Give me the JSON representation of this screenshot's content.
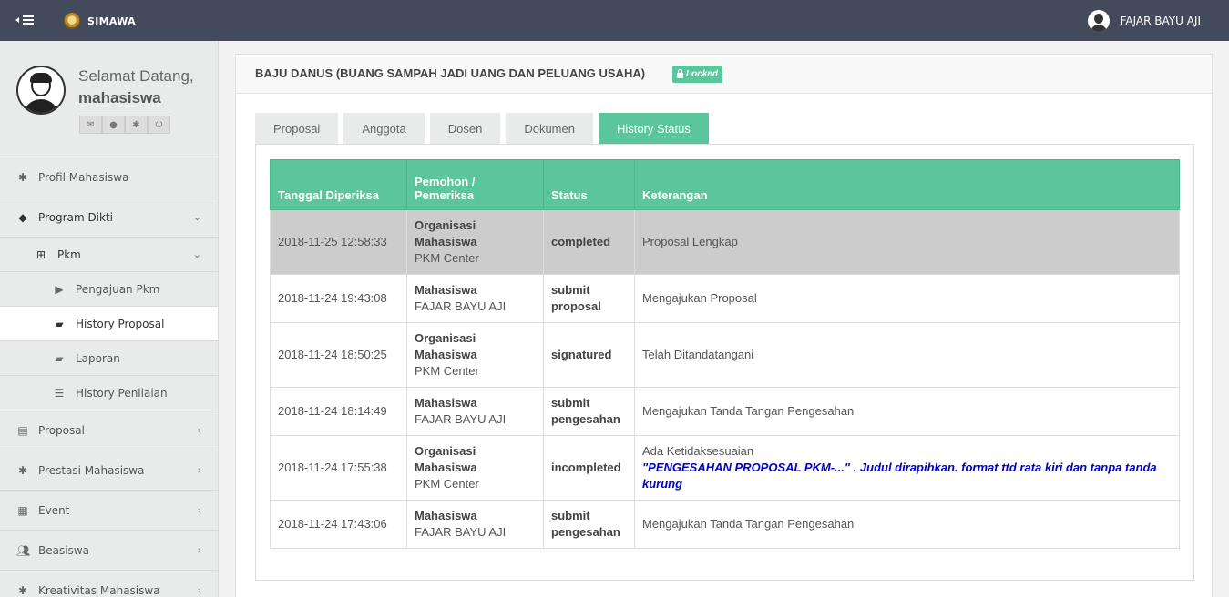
{
  "topbar": {
    "app_name": "SIMAWA",
    "user_name": "FAJAR BAYU AJI"
  },
  "sidebar": {
    "greeting": "Selamat Datang,",
    "role": "mahasiswa",
    "quick_icons": [
      "envelope-icon",
      "user-icon",
      "gear-icon",
      "power-icon"
    ],
    "items": [
      {
        "label": "Profil Mahasiswa",
        "icon": "asterisk-icon"
      },
      {
        "label": "Program Dikti",
        "icon": "tags-icon",
        "expanded": true
      },
      {
        "label": "Pkm",
        "icon": "plus-square-icon",
        "expanded": true
      },
      {
        "label": "Pengajuan Pkm",
        "icon": "play-square-icon"
      },
      {
        "label": "History Proposal",
        "icon": "book-icon",
        "active": true
      },
      {
        "label": "Laporan",
        "icon": "book-icon"
      },
      {
        "label": "History Penilaian",
        "icon": "list-alt-icon"
      },
      {
        "label": "Proposal",
        "icon": "file-icon"
      },
      {
        "label": "Prestasi Mahasiswa",
        "icon": "asterisk-icon"
      },
      {
        "label": "Event",
        "icon": "calendar-icon"
      },
      {
        "label": "Beasiswa",
        "icon": "users-icon"
      },
      {
        "label": "Kreativitas Mahasiswa",
        "icon": "asterisk-icon"
      }
    ]
  },
  "panel": {
    "title": "BAJU DANUS (BUANG SAMPAH JADI UANG DAN PELUANG USAHA)",
    "badge": "Locked",
    "tabs": [
      "Proposal",
      "Anggota",
      "Dosen",
      "Dokumen",
      "History Status"
    ],
    "active_tab": "History Status"
  },
  "table": {
    "headers": [
      "Tanggal Diperiksa",
      "Pemohon / Pemeriksa",
      "Status",
      "Keterangan"
    ],
    "rows": [
      {
        "date": "2018-11-25 12:58:33",
        "role": "Organisasi Mahasiswa",
        "name": "PKM Center",
        "status": "completed",
        "note": "Proposal Lengkap",
        "note2": "",
        "highlight": true
      },
      {
        "date": "2018-11-24 19:43:08",
        "role": "Mahasiswa",
        "name": "FAJAR BAYU AJI",
        "status": "submit proposal",
        "note": "Mengajukan Proposal",
        "note2": ""
      },
      {
        "date": "2018-11-24 18:50:25",
        "role": "Organisasi Mahasiswa",
        "name": "PKM Center",
        "status": "signatured",
        "note": "Telah Ditandatangani",
        "note2": ""
      },
      {
        "date": "2018-11-24 18:14:49",
        "role": "Mahasiswa",
        "name": "FAJAR BAYU AJI",
        "status": "submit pengesahan",
        "note": "Mengajukan Tanda Tangan Pengesahan",
        "note2": ""
      },
      {
        "date": "2018-11-24 17:55:38",
        "role": "Organisasi Mahasiswa",
        "name": "PKM Center",
        "status": "incompleted",
        "note": "Ada Ketidaksesuaian",
        "note2": "\"PENGESAHAN PROPOSAL PKM-...\" . Judul dirapihkan. format ttd rata kiri dan tanpa tanda kurung"
      },
      {
        "date": "2018-11-24 17:43:06",
        "role": "Mahasiswa",
        "name": "FAJAR BAYU AJI",
        "status": "submit pengesahan",
        "note": "Mengajukan Tanda Tangan Pengesahan",
        "note2": ""
      }
    ]
  },
  "colors": {
    "topbar": "#424a5c",
    "accent": "#5bc69b",
    "note_blue": "#0000cc",
    "highlight_row": "#cccccc"
  }
}
